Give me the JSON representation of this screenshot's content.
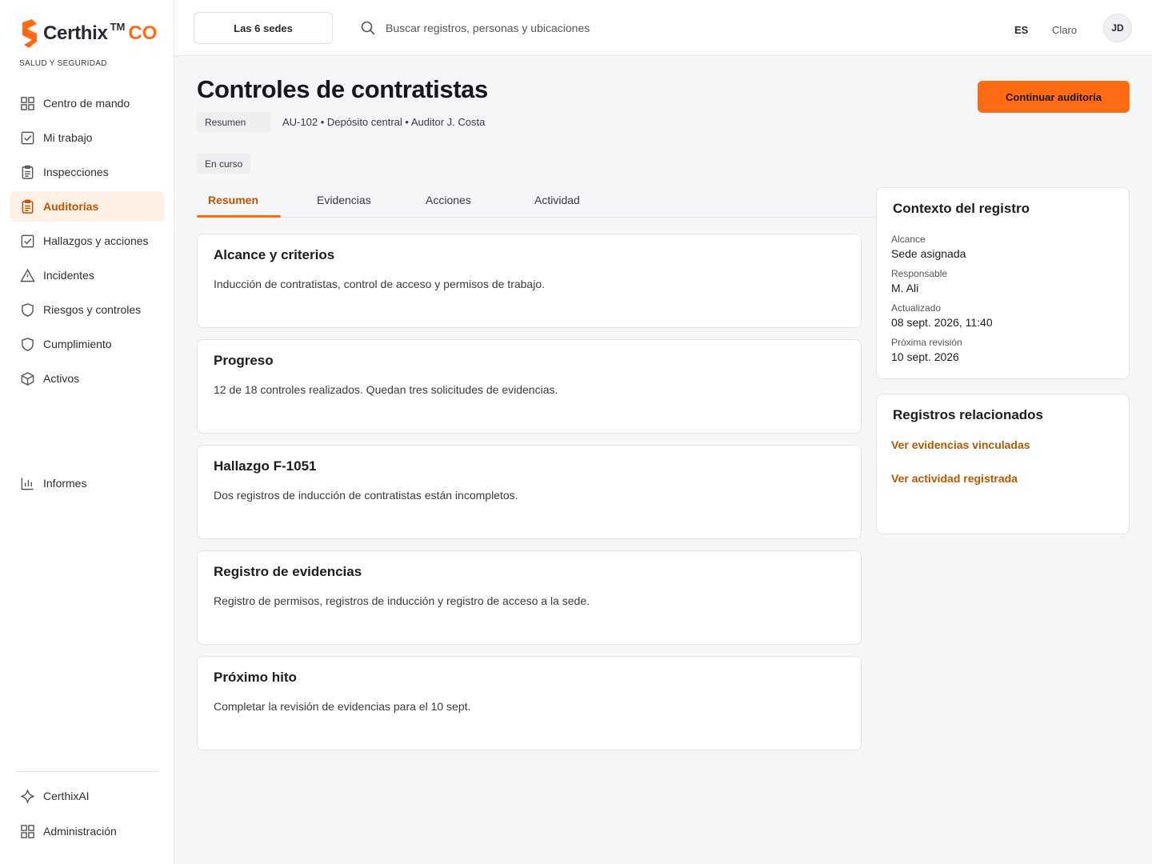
{
  "brand": {
    "name": "Certhix",
    "tm": "TM",
    "suffix": "CO",
    "subtitle": "SALUD Y SEGURIDAD",
    "accent": "#ff6a13"
  },
  "sidebar": {
    "items": [
      {
        "label": "Centro de mando",
        "icon": "grid-icon"
      },
      {
        "label": "Mi trabajo",
        "icon": "check-square-icon"
      },
      {
        "label": "Inspecciones",
        "icon": "clipboard-icon"
      },
      {
        "label": "Auditorías",
        "icon": "clipboard-icon",
        "active": true
      },
      {
        "label": "Hallazgos y acciones",
        "icon": "check-square-icon"
      },
      {
        "label": "Incidentes",
        "icon": "warning-triangle-icon"
      },
      {
        "label": "Riesgos y controles",
        "icon": "shield-icon"
      },
      {
        "label": "Cumplimiento",
        "icon": "shield-icon"
      },
      {
        "label": "Activos",
        "icon": "box-icon"
      }
    ],
    "reports": {
      "label": "Informes",
      "icon": "bar-chart-icon"
    },
    "bottom": [
      {
        "label": "CerthixAI",
        "icon": "sparkle-icon"
      },
      {
        "label": "Administración",
        "icon": "grid-icon"
      }
    ]
  },
  "topbar": {
    "site_selector": "Las 6 sedes",
    "search_placeholder": "Buscar registros, personas y ubicaciones",
    "language": "ES",
    "theme": "Claro",
    "avatar_initials": "JD"
  },
  "page": {
    "title": "Controles de contratistas",
    "summary_chip": "Resumen",
    "meta": "AU-102 • Depósito central • Auditor J. Costa",
    "status": "En curso",
    "cta": "Continuar auditoría"
  },
  "tabs": [
    {
      "label": "Resumen",
      "active": true
    },
    {
      "label": "Evidencias"
    },
    {
      "label": "Acciones"
    },
    {
      "label": "Actividad"
    }
  ],
  "cards": [
    {
      "title": "Alcance y criterios",
      "body": "Inducción de contratistas, control de acceso y permisos de trabajo."
    },
    {
      "title": "Progreso",
      "body": "12 de 18 controles realizados. Quedan tres solicitudes de evidencias."
    },
    {
      "title": "Hallazgo F-1051",
      "body": "Dos registros de inducción de contratistas están incompletos."
    },
    {
      "title": "Registro de evidencias",
      "body": "Registro de permisos, registros de inducción y registro de acceso a la sede."
    },
    {
      "title": "Próximo hito",
      "body": "Completar la revisión de evidencias para el 10 sept."
    }
  ],
  "context": {
    "title": "Contexto del registro",
    "fields": [
      {
        "label": "Alcance",
        "value": "Sede asignada"
      },
      {
        "label": "Responsable",
        "value": "M. Ali"
      },
      {
        "label": "Actualizado",
        "value": "08 sept. 2026, 11:40"
      },
      {
        "label": "Próxima revisión",
        "value": "10 sept. 2026"
      }
    ]
  },
  "related": {
    "title": "Registros relacionados",
    "links": [
      "Ver evidencias vinculadas",
      "Ver actividad registrada"
    ]
  }
}
